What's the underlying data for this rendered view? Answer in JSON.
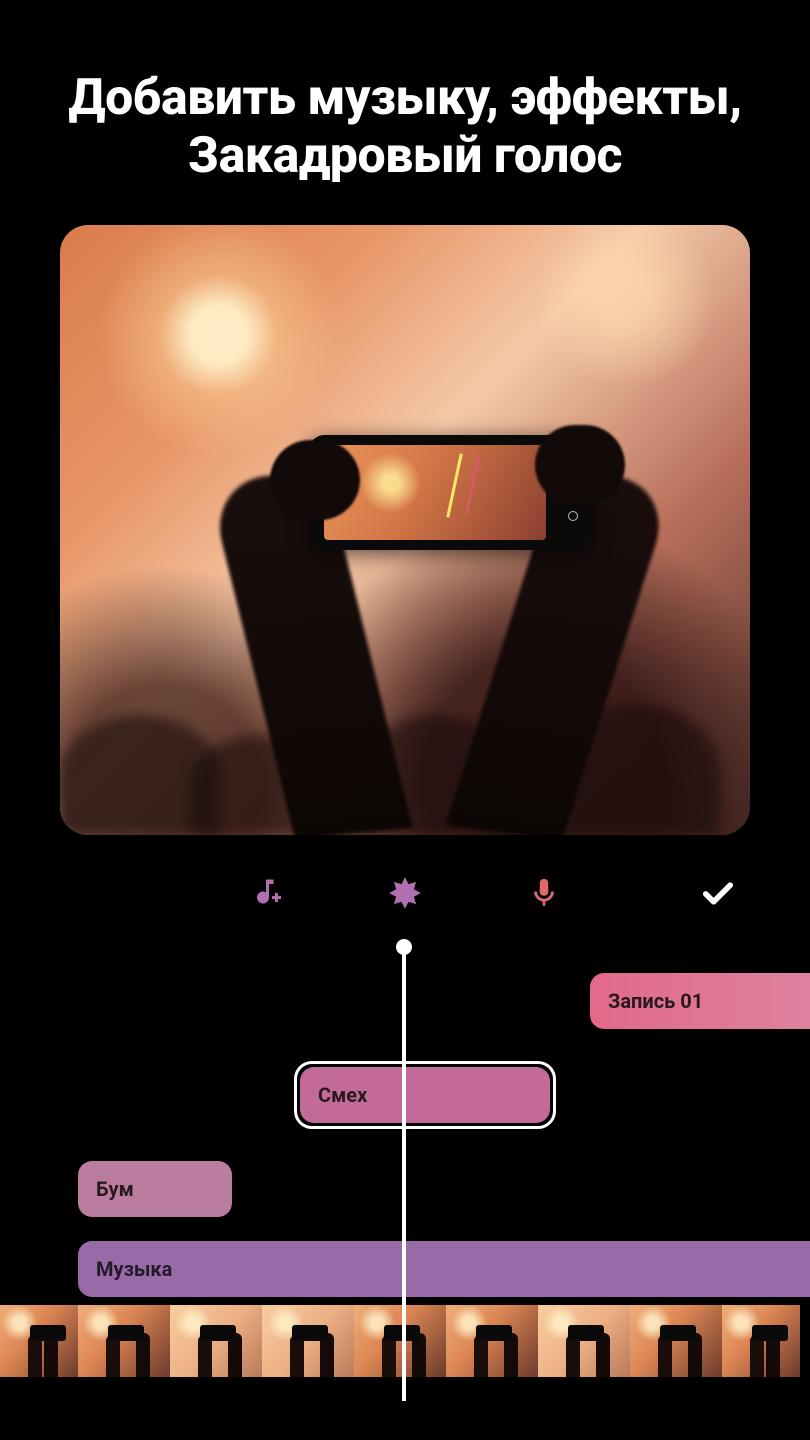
{
  "headline": "Добавить музыку, эффекты, Закадровый голос",
  "toolbar": {
    "music_icon": "music-plus-icon",
    "effects_icon": "starburst-icon",
    "voice_icon": "microphone-icon",
    "confirm_icon": "checkmark-icon"
  },
  "timeline": {
    "clips": {
      "record": {
        "label": "Запись 01"
      },
      "laugh": {
        "label": "Смех"
      },
      "boom": {
        "label": "Бум"
      },
      "music": {
        "label": "Музыка"
      }
    }
  },
  "colors": {
    "accent_pink": "#c26b9a",
    "accent_purple": "#986aa6",
    "accent_red": "#e2698a",
    "mic": "#dd6a6a",
    "icon_purple": "#b06fb0"
  }
}
